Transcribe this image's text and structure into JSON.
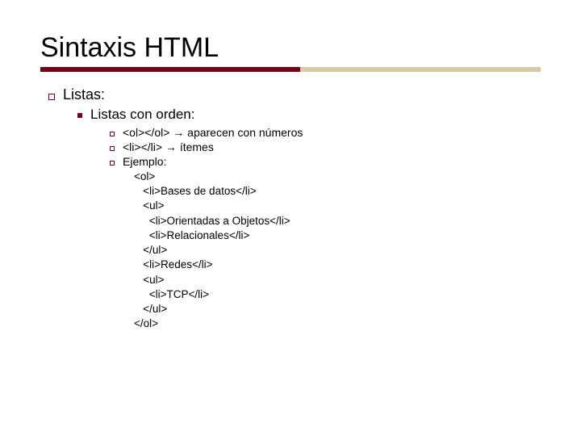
{
  "title": "Sintaxis HTML",
  "lvl1": {
    "text": "Listas:"
  },
  "lvl2": {
    "text": "Listas con orden:"
  },
  "lvl3": {
    "item1": "<ol></ol> → aparecen con números",
    "item2": "<li></li> → ítemes",
    "item3": "Ejemplo:"
  },
  "code": {
    "l1": "<ol>",
    "l2": "   <li>Bases de datos</li>",
    "l3": "   <ul>",
    "l4": "     <li>Orientadas a Objetos</li>",
    "l5": "     <li>Relacionales</li>",
    "l6": "   </ul>",
    "l7": "   <li>Redes</li>",
    "l8": "   <ul>",
    "l9": "     <li>TCP</li>",
    "l10": "   </ul>",
    "l11": "</ol>"
  }
}
